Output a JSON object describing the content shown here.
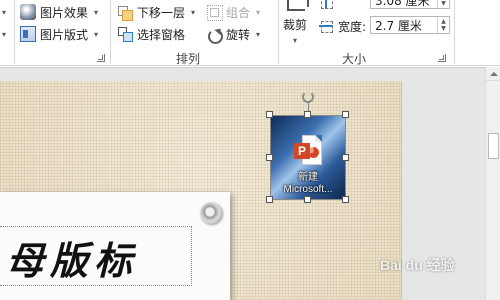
{
  "ribbon": {
    "picture_styles": {
      "effects_label": "图片效果",
      "layout_label": "图片版式"
    },
    "arrange": {
      "send_backward_label": "下移一层",
      "selection_pane_label": "选择窗格",
      "group_label": "组合",
      "rotate_label": "旋转",
      "group_title": "排列"
    },
    "size": {
      "crop_label": "裁剪",
      "height_value": "3.08 厘米",
      "width_label": "宽度:",
      "width_value": "2.7 厘米",
      "group_title": "大小"
    }
  },
  "slide": {
    "card_text": "母版标",
    "picture_caption_line1": "新建",
    "picture_caption_line2": "Microsoft..."
  },
  "watermark": "Bai du 经验"
}
